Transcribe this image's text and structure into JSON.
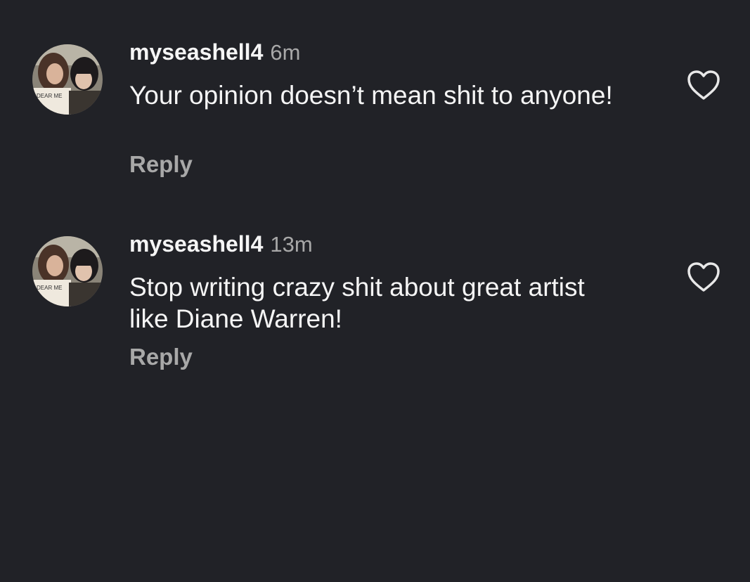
{
  "comments": [
    {
      "username": "myseashell4",
      "time": "6m",
      "text": "Your opinion doesn’t mean shit to anyone!",
      "reply_label": "Reply",
      "avatar_shirt_text": "DEAR ME",
      "like_icon": "heart-outline-icon"
    },
    {
      "username": "myseashell4",
      "time": "13m",
      "text": "Stop writing crazy shit about great artist like Diane Warren!",
      "reply_label": "Reply",
      "avatar_shirt_text": "DEAR ME",
      "like_icon": "heart-outline-icon"
    }
  ],
  "colors": {
    "background": "#212227",
    "primary_text": "#f5f5f5",
    "secondary_text": "#a8a8a8"
  }
}
